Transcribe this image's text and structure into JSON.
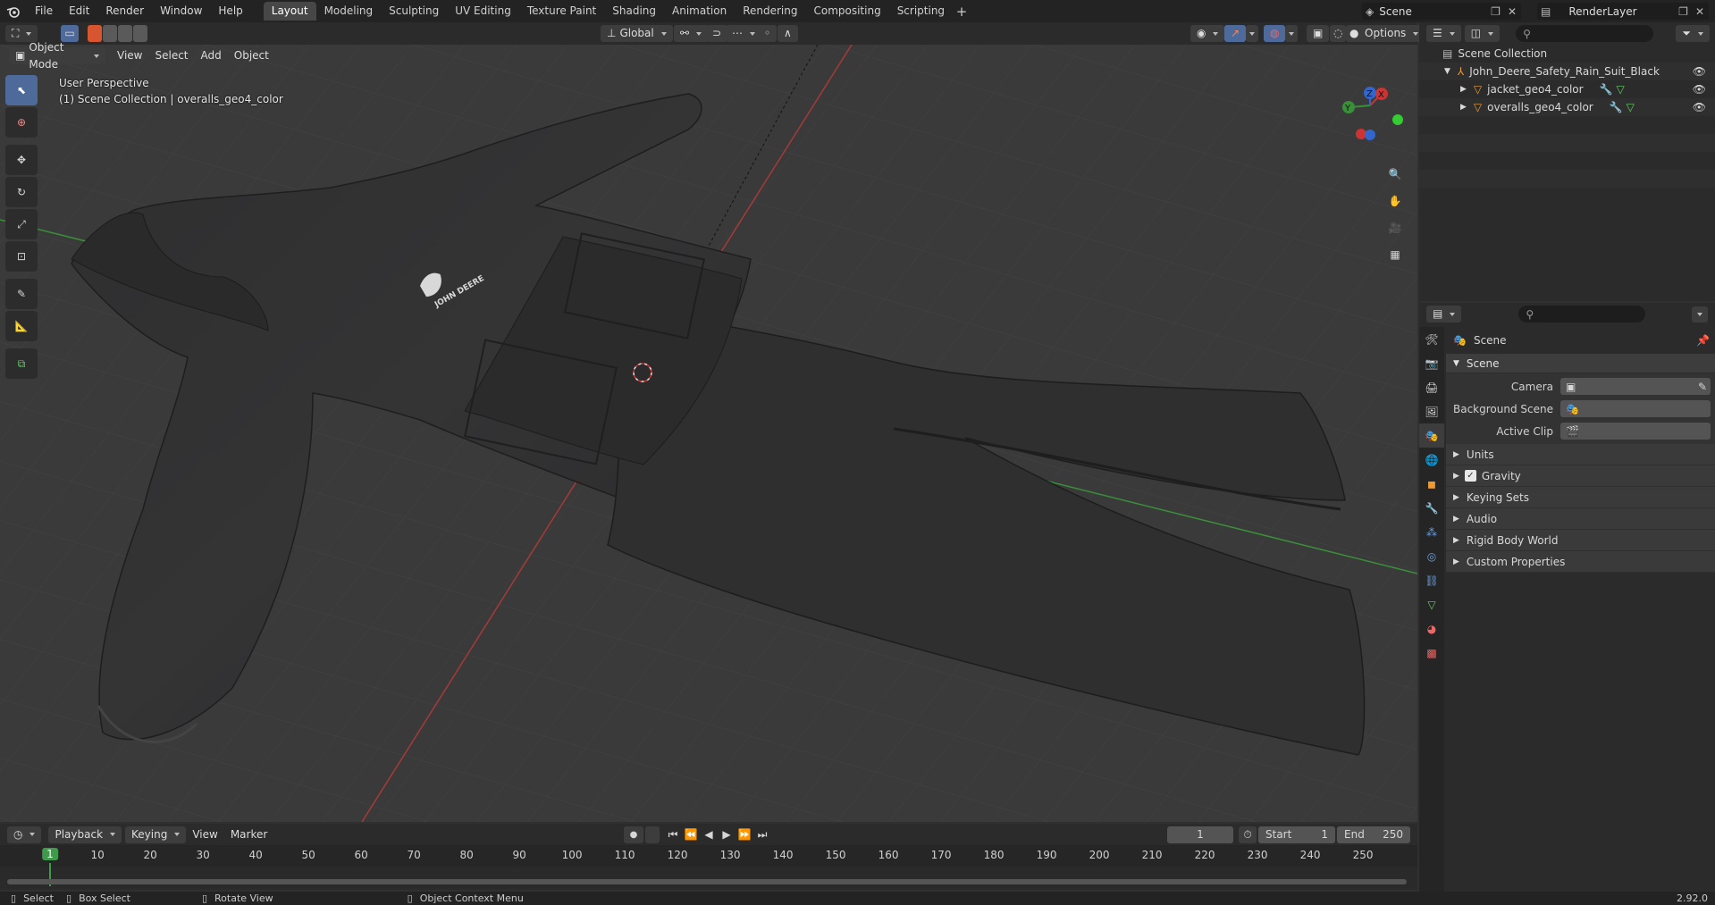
{
  "topbar": {
    "menus": [
      "File",
      "Edit",
      "Render",
      "Window",
      "Help"
    ],
    "workspaces": [
      "Layout",
      "Modeling",
      "Sculpting",
      "UV Editing",
      "Texture Paint",
      "Shading",
      "Animation",
      "Rendering",
      "Compositing",
      "Scripting"
    ],
    "active_workspace": "Layout",
    "add_label": "+",
    "scene_name": "Scene",
    "view_layer": "RenderLayer"
  },
  "viewport_header": {
    "mode": "Object Mode",
    "menus": [
      "View",
      "Select",
      "Add",
      "Object"
    ],
    "transform_orientation": "Global",
    "options_label": "Options"
  },
  "viewport": {
    "perspective_label": "User Perspective",
    "collection_info": "(1) Scene Collection | overalls_geo4_color",
    "logo_text": "JOHN DEERE",
    "gizmo_axes": [
      "X",
      "Y",
      "Z"
    ]
  },
  "outliner": {
    "root": "Scene Collection",
    "collection": "John_Deere_Safety_Rain_Suit_Black",
    "objects": [
      "jacket_geo4_color",
      "overalls_geo4_color"
    ]
  },
  "properties": {
    "context_title": "Scene",
    "panel_title": "Scene",
    "fields": [
      {
        "label": "Camera"
      },
      {
        "label": "Background Scene"
      },
      {
        "label": "Active Clip"
      }
    ],
    "subpanels": [
      "Units",
      "Gravity",
      "Keying Sets",
      "Audio",
      "Rigid Body World",
      "Custom Properties"
    ],
    "gravity_checked": true
  },
  "timeline": {
    "menus": [
      "Playback",
      "Keying",
      "View",
      "Marker"
    ],
    "current_frame": "1",
    "start_label": "Start",
    "start_value": "1",
    "end_label": "End",
    "end_value": "250",
    "ruler_ticks": [
      "1",
      "10",
      "20",
      "30",
      "40",
      "50",
      "60",
      "70",
      "80",
      "90",
      "100",
      "110",
      "120",
      "130",
      "140",
      "150",
      "160",
      "170",
      "180",
      "190",
      "200",
      "210",
      "220",
      "230",
      "240",
      "250"
    ]
  },
  "statusbar": {
    "select": "Select",
    "box_select": "Box Select",
    "rotate_view": "Rotate View",
    "context_menu": "Object Context Menu",
    "version": "2.92.0"
  },
  "colors": {
    "accent": "#4d6a9a",
    "active_tool": "#4d6a9a",
    "frame_marker": "#3f9a4b",
    "x_axis": "#c03a3a",
    "y_axis": "#3d9a3d",
    "z_axis": "#3a6ec0"
  }
}
